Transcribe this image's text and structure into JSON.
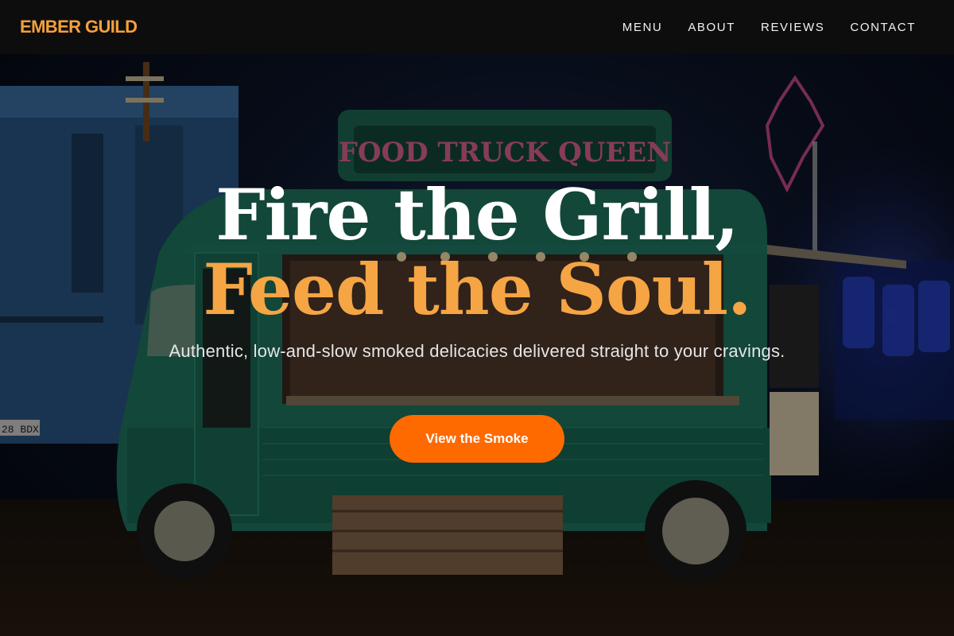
{
  "brand": {
    "name": "EMBER GUILD"
  },
  "nav": [
    {
      "label": "MENU"
    },
    {
      "label": "ABOUT"
    },
    {
      "label": "REVIEWS"
    },
    {
      "label": "CONTACT"
    }
  ],
  "hero": {
    "headline_line1": "Fire the Grill,",
    "headline_line2": "Feed the Soul.",
    "subtitle": "Authentic, low-and-slow smoked delicacies delivered straight to your cravings.",
    "cta_label": "View the Smoke",
    "truck_sign": "FOOD TRUCK QUEEN",
    "plate": "28 BDX"
  },
  "colors": {
    "accent": "#f5a03c",
    "cta": "#ff6a00",
    "header_bg": "#0d0d0d"
  }
}
